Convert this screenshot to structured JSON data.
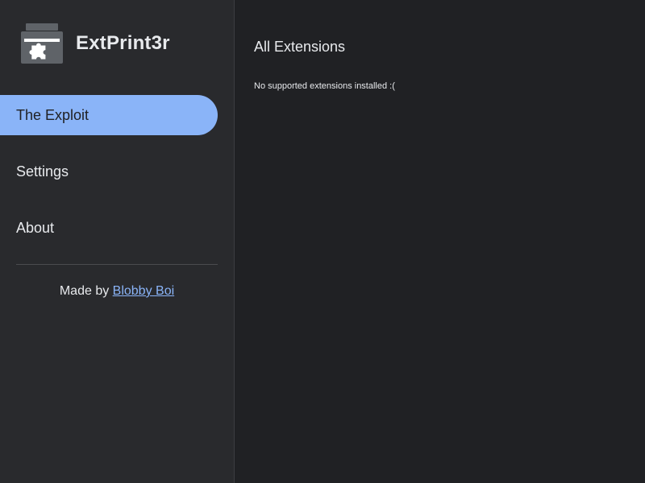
{
  "brand": {
    "logo_icon": "printer-puzzle-icon",
    "title": "ExtPrint3r"
  },
  "sidebar": {
    "items": [
      {
        "label": "The Exploit",
        "active": true
      },
      {
        "label": "Settings",
        "active": false
      },
      {
        "label": "About",
        "active": false
      }
    ],
    "credits": {
      "prefix": "Made by ",
      "author": "Blobby Boi"
    }
  },
  "main": {
    "title": "All Extensions",
    "empty_message": "No supported extensions installed :("
  },
  "colors": {
    "accent": "#8ab4f8",
    "sidebar_bg": "#292a2d",
    "main_bg": "#202124",
    "text": "#e8eaed"
  }
}
